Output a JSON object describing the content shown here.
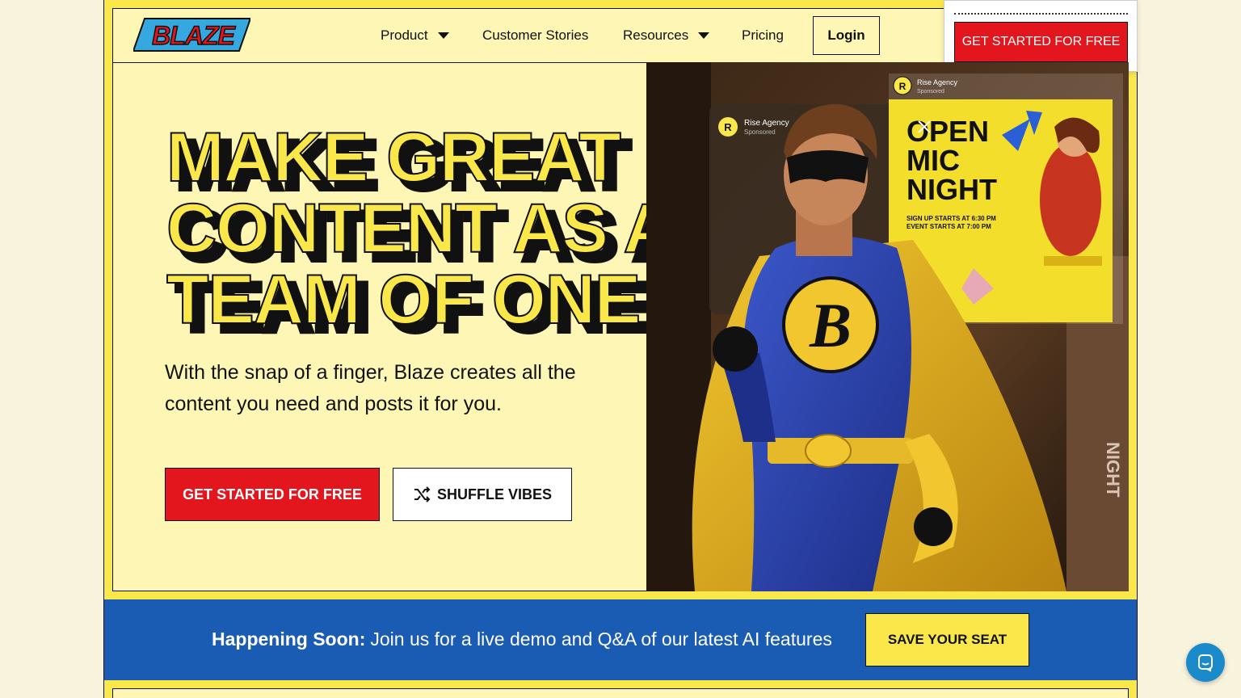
{
  "brand": {
    "logo_text": "BLAZE"
  },
  "nav": {
    "product": "Product",
    "customer_stories": "Customer Stories",
    "resources": "Resources",
    "pricing": "Pricing",
    "login": "Login"
  },
  "header_cta": "GET STARTED FOR FREE",
  "hero": {
    "headline_lines": [
      "MAKE GREAT",
      "CONTENT AS A",
      "TEAM OF ONE"
    ],
    "subtext": "With the snap of a finger, Blaze creates all the content you need and posts it for you.",
    "primary_cta": "GET STARTED FOR FREE",
    "secondary_cta": "SHUFFLE VIBES"
  },
  "ad_cards": {
    "agency": "Rise Agency",
    "sponsored": "Sponsored",
    "poster_title": [
      "OPEN",
      "MIC",
      "NIGHT"
    ],
    "poster_info": [
      "SIGN UP STARTS AT 6:30 PM",
      "EVENT STARTS AT 7:00 PM"
    ],
    "hero_letter": "B"
  },
  "banner": {
    "label": "Happening Soon:",
    "text": "Join us for a live demo and Q&A of our latest AI features",
    "button": "SAVE YOUR SEAT"
  },
  "colors": {
    "yellow": "#fae84a",
    "cream": "#fdf6b5",
    "red": "#e3161d",
    "blue": "#1a5bb4",
    "chat_blue": "#1a8acb"
  },
  "icons": [
    "caret-down-icon",
    "shuffle-icon",
    "close-icon",
    "chat-icon",
    "verified-icon"
  ]
}
